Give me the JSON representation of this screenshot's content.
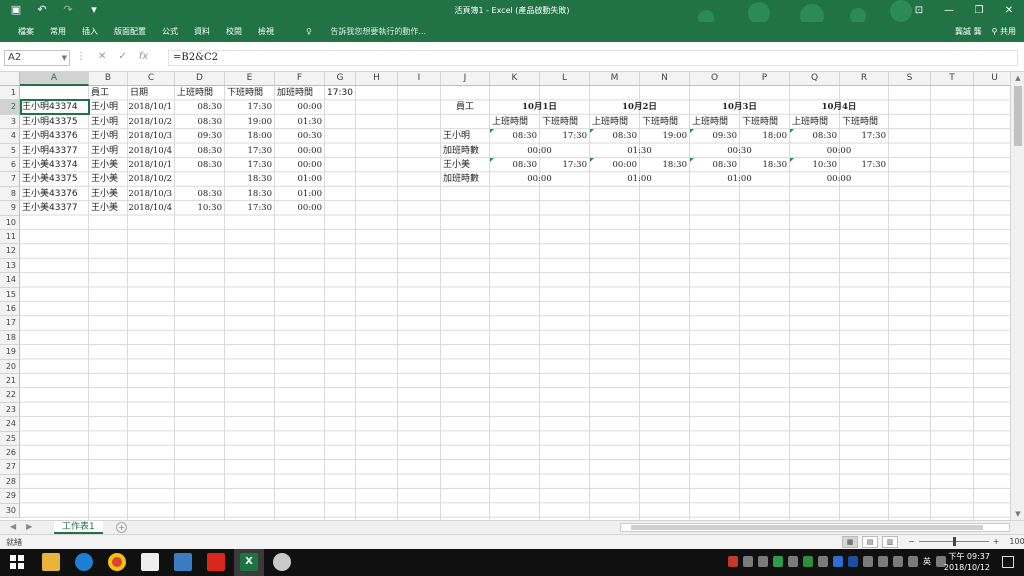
{
  "window": {
    "title": "活頁簿1 - Excel (產品啟動失敗)",
    "qat_icons": [
      "save-icon",
      "undo-icon",
      "redo-icon",
      "customize-icon"
    ],
    "buttons": [
      "ribbon-display-icon",
      "minimize-icon",
      "restore-icon",
      "close-icon"
    ]
  },
  "ribbon": {
    "tabs": [
      "檔案",
      "常用",
      "插入",
      "版面配置",
      "公式",
      "資料",
      "校閱",
      "檢視"
    ],
    "tell_me": "告訴我您想要執行的動作...",
    "user": "龔誠 龔",
    "share": "共用"
  },
  "formula_bar": {
    "name_box": "A2",
    "formula": "=B2&C2",
    "cancel_icon": "✕",
    "enter_icon": "✓",
    "fx_label": "fx"
  },
  "grid": {
    "columns": [
      "A",
      "B",
      "C",
      "D",
      "E",
      "F",
      "G",
      "H",
      "I",
      "J",
      "K",
      "L",
      "M",
      "N",
      "O",
      "P",
      "Q",
      "R",
      "S",
      "T",
      "U"
    ],
    "rows": [
      "1",
      "2",
      "3",
      "4",
      "5",
      "6",
      "7",
      "8",
      "9",
      "10",
      "11",
      "12",
      "13",
      "14",
      "15",
      "16",
      "17",
      "18",
      "19",
      "20",
      "21",
      "22",
      "23",
      "24",
      "25",
      "26",
      "27",
      "28",
      "29",
      "30"
    ],
    "selected_column": "A",
    "selected_row": "2"
  },
  "left_table": {
    "headers": [
      "員工",
      "日期",
      "上班時間",
      "下班時間",
      "加班時間",
      "17:30"
    ],
    "rows": [
      {
        "a": "王小明43374",
        "b": "王小明",
        "c": "2018/10/1",
        "d": "08:30",
        "e": "17:30",
        "f": "00:00"
      },
      {
        "a": "王小明43375",
        "b": "王小明",
        "c": "2018/10/2",
        "d": "08:30",
        "e": "19:00",
        "f": "01:30"
      },
      {
        "a": "王小明43376",
        "b": "王小明",
        "c": "2018/10/3",
        "d": "09:30",
        "e": "18:00",
        "f": "00:30"
      },
      {
        "a": "王小明43377",
        "b": "王小明",
        "c": "2018/10/4",
        "d": "08:30",
        "e": "17:30",
        "f": "00:00"
      },
      {
        "a": "王小美43374",
        "b": "王小美",
        "c": "2018/10/1",
        "d": "08:30",
        "e": "17:30",
        "f": "00:00"
      },
      {
        "a": "王小美43375",
        "b": "王小美",
        "c": "2018/10/2",
        "d": "",
        "e": "18:30",
        "f": "01:00"
      },
      {
        "a": "王小美43376",
        "b": "王小美",
        "c": "2018/10/3",
        "d": "08:30",
        "e": "18:30",
        "f": "01:00"
      },
      {
        "a": "王小美43377",
        "b": "王小美",
        "c": "2018/10/4",
        "d": "10:30",
        "e": "17:30",
        "f": "00:00"
      }
    ]
  },
  "right_table": {
    "employee_header": "員工",
    "dates": [
      "10月1日",
      "10月2日",
      "10月3日",
      "10月4日"
    ],
    "sub_headers": [
      "上班時間",
      "下班時間"
    ],
    "overtime_label": "加班時數",
    "employees": [
      {
        "name": "王小明",
        "times": [
          "08:30",
          "17:30",
          "08:30",
          "19:00",
          "09:30",
          "18:00",
          "08:30",
          "17:30"
        ],
        "overtime": [
          "00:00",
          "01:30",
          "00:30",
          "00:00"
        ]
      },
      {
        "name": "王小美",
        "times": [
          "08:30",
          "17:30",
          "00:00",
          "18:30",
          "08:30",
          "18:30",
          "10:30",
          "17:30"
        ],
        "overtime": [
          "00:00",
          "01:00",
          "01:00",
          "00:00"
        ]
      }
    ]
  },
  "sheet_tabs": {
    "active": "工作表1",
    "add": "+"
  },
  "status": {
    "ready": "就緒",
    "zoom": "100%",
    "zoom_minus": "−",
    "zoom_plus": "+"
  },
  "taskbar": {
    "time": "下午 09:37",
    "date": "2018/10/12",
    "ime": "英",
    "apps": [
      "file-explorer-icon",
      "edge-icon",
      "chrome-icon",
      "files-icon",
      "box-icon",
      "pdf-icon",
      "excel-icon",
      "app-icon"
    ]
  },
  "colors": {
    "excel_green": "#217346",
    "taskbar": "#101010",
    "fill_handle_marker": "#1a9a3a"
  }
}
